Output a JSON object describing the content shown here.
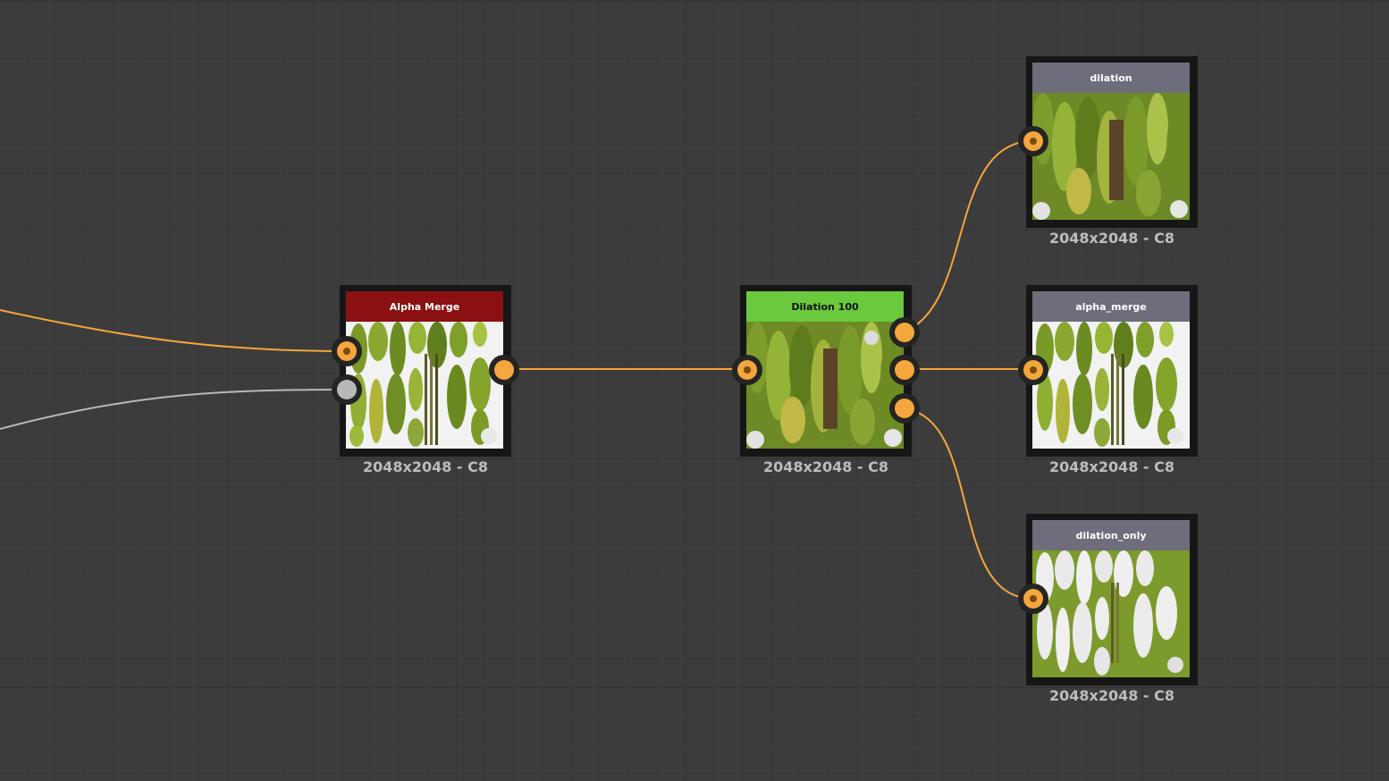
{
  "nodes": {
    "alpha_merge_node": {
      "title": "Alpha Merge",
      "caption": "2048x2048 - C8",
      "header_color": "#8b1011",
      "header_text_color": "#ffffff"
    },
    "dilation_node": {
      "title": "Dilation 100",
      "caption": "2048x2048 - C8",
      "header_color": "#6ac93c",
      "header_text_color": "#111111"
    },
    "output_dilation": {
      "title": "dilation",
      "caption": "2048x2048 - C8",
      "header_color": "#6d6d7c",
      "header_text_color": "#ffffff"
    },
    "output_alpha_merge": {
      "title": "alpha_merge",
      "caption": "2048x2048 - C8",
      "header_color": "#6d6d7c",
      "header_text_color": "#ffffff"
    },
    "output_dilation_only": {
      "title": "dilation_only",
      "caption": "2048x2048 - C8",
      "header_color": "#6d6d7c",
      "header_text_color": "#ffffff"
    }
  },
  "colors": {
    "wire_color": "#f5a63c",
    "grey_wire_color": "#b8b8b8",
    "port_color": "#f5a63c"
  }
}
